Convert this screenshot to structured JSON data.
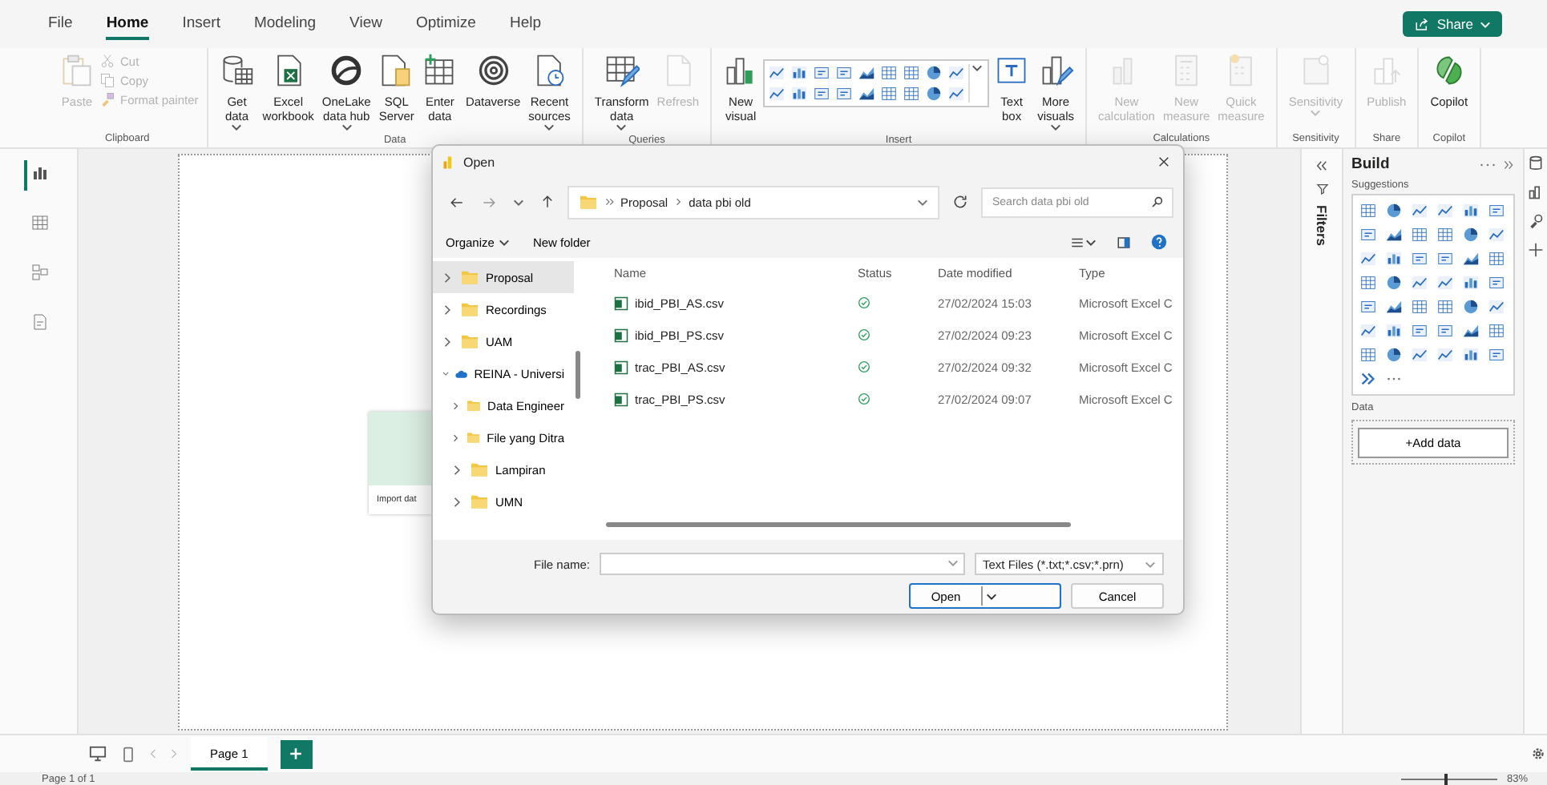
{
  "menu_tabs": [
    {
      "label": "File",
      "selected": false
    },
    {
      "label": "Home",
      "selected": true
    },
    {
      "label": "Insert",
      "selected": false
    },
    {
      "label": "Modeling",
      "selected": false
    },
    {
      "label": "View",
      "selected": false
    },
    {
      "label": "Optimize",
      "selected": false
    },
    {
      "label": "Help",
      "selected": false
    }
  ],
  "share_button": {
    "label": "Share"
  },
  "ribbon": {
    "groups": [
      {
        "title": "Clipboard",
        "items": [
          {
            "kind": "large",
            "lines": [
              "Paste"
            ],
            "disabled": true,
            "dropdown": false
          },
          {
            "kind": "small",
            "lines": [
              "Cut"
            ],
            "disabled": true
          },
          {
            "kind": "small",
            "lines": [
              "Copy"
            ],
            "disabled": true
          },
          {
            "kind": "small",
            "lines": [
              "Format painter"
            ],
            "disabled": true
          }
        ]
      },
      {
        "title": "Data",
        "items": [
          {
            "kind": "large",
            "lines": [
              "Get",
              "data"
            ],
            "disabled": false,
            "dropdown": true
          },
          {
            "kind": "large",
            "lines": [
              "Excel",
              "workbook"
            ],
            "disabled": false,
            "dropdown": false
          },
          {
            "kind": "large",
            "lines": [
              "OneLake",
              "data hub"
            ],
            "disabled": false,
            "dropdown": true
          },
          {
            "kind": "large",
            "lines": [
              "SQL",
              "Server"
            ],
            "disabled": false,
            "dropdown": false
          },
          {
            "kind": "large",
            "lines": [
              "Enter",
              "data"
            ],
            "disabled": false,
            "dropdown": false
          },
          {
            "kind": "large",
            "lines": [
              "Dataverse"
            ],
            "disabled": false,
            "dropdown": false
          },
          {
            "kind": "large",
            "lines": [
              "Recent",
              "sources"
            ],
            "disabled": false,
            "dropdown": true
          }
        ]
      },
      {
        "title": "Queries",
        "items": [
          {
            "kind": "large",
            "lines": [
              "Transform",
              "data"
            ],
            "disabled": false,
            "dropdown": true
          },
          {
            "kind": "large",
            "lines": [
              "Refresh"
            ],
            "disabled": true,
            "dropdown": false
          }
        ]
      },
      {
        "title": "Insert",
        "items": [
          {
            "kind": "large",
            "lines": [
              "New",
              "visual"
            ],
            "disabled": false,
            "dropdown": false
          },
          {
            "kind": "gallery",
            "dropdown": true
          },
          {
            "kind": "large",
            "lines": [
              "Text",
              "box"
            ],
            "disabled": false,
            "dropdown": false
          },
          {
            "kind": "large",
            "lines": [
              "More",
              "visuals"
            ],
            "disabled": false,
            "dropdown": true
          }
        ]
      },
      {
        "title": "Calculations",
        "items": [
          {
            "kind": "large",
            "lines": [
              "New",
              "calculation"
            ],
            "disabled": true,
            "dropdown": false
          },
          {
            "kind": "large",
            "lines": [
              "New",
              "measure"
            ],
            "disabled": true,
            "dropdown": false
          },
          {
            "kind": "large",
            "lines": [
              "Quick",
              "measure"
            ],
            "disabled": true,
            "dropdown": false
          }
        ]
      },
      {
        "title": "Sensitivity",
        "items": [
          {
            "kind": "large",
            "lines": [
              "Sensitivity"
            ],
            "disabled": true,
            "dropdown": true
          }
        ]
      },
      {
        "title": "Share",
        "items": [
          {
            "kind": "large",
            "lines": [
              "Publish"
            ],
            "disabled": true,
            "dropdown": false
          }
        ]
      },
      {
        "title": "Copilot",
        "items": [
          {
            "kind": "large",
            "lines": [
              "Copilot"
            ],
            "disabled": false,
            "dropdown": false
          }
        ]
      }
    ]
  },
  "views": [
    {
      "selected": true
    },
    {
      "selected": false
    },
    {
      "selected": false
    },
    {
      "selected": false
    }
  ],
  "canvas": {
    "card_label": "Import dat"
  },
  "dialog": {
    "title": "Open",
    "breadcrumb": [
      "Proposal",
      "data pbi old"
    ],
    "search": {
      "placeholder": "Search data pbi old"
    },
    "toolbar": [
      "Organize",
      "New folder"
    ],
    "nav_tree": [
      {
        "label": "Proposal",
        "kind": "folder",
        "selected": true,
        "expanded": false
      },
      {
        "label": "Recordings",
        "kind": "folder",
        "selected": false,
        "expanded": false
      },
      {
        "label": "UAM",
        "kind": "folder",
        "selected": false,
        "expanded": false
      },
      {
        "label": "REINA - Universi",
        "kind": "cloud",
        "selected": false,
        "expanded": true,
        "children": [
          {
            "label": "Data Engineer",
            "kind": "folder",
            "selected": false,
            "expanded": false
          },
          {
            "label": "File yang Ditra",
            "kind": "folder",
            "selected": false,
            "expanded": false
          },
          {
            "label": "Lampiran",
            "kind": "folder",
            "selected": false,
            "expanded": false
          },
          {
            "label": "UMN",
            "kind": "folder",
            "selected": false,
            "expanded": false
          }
        ]
      }
    ],
    "columns": [
      "Name",
      "Status",
      "Date modified",
      "Type"
    ],
    "files": [
      {
        "name": "ibid_PBI_AS.csv",
        "date": "27/02/2024 15:03",
        "type": "Microsoft Excel C"
      },
      {
        "name": "ibid_PBI_PS.csv",
        "date": "27/02/2024 09:23",
        "type": "Microsoft Excel C"
      },
      {
        "name": "trac_PBI_AS.csv",
        "date": "27/02/2024 09:32",
        "type": "Microsoft Excel C"
      },
      {
        "name": "trac_PBI_PS.csv",
        "date": "27/02/2024 09:07",
        "type": "Microsoft Excel C"
      }
    ],
    "file_name_label": "File name:",
    "file_type": "Text Files (*.txt;*.csv;*.prn)",
    "buttons": [
      "Open",
      "Cancel"
    ]
  },
  "filters_pane": {
    "label": "Filters"
  },
  "build_pane": {
    "title": "Build",
    "section": "Suggestions",
    "data_title": "Data",
    "add_button": "+Add data"
  },
  "page_tabs": [
    {
      "label": "Page 1",
      "selected": true
    }
  ],
  "status_bar": {
    "page": "Page 1 of 1",
    "zoom": "83%",
    "level": 0.45
  }
}
